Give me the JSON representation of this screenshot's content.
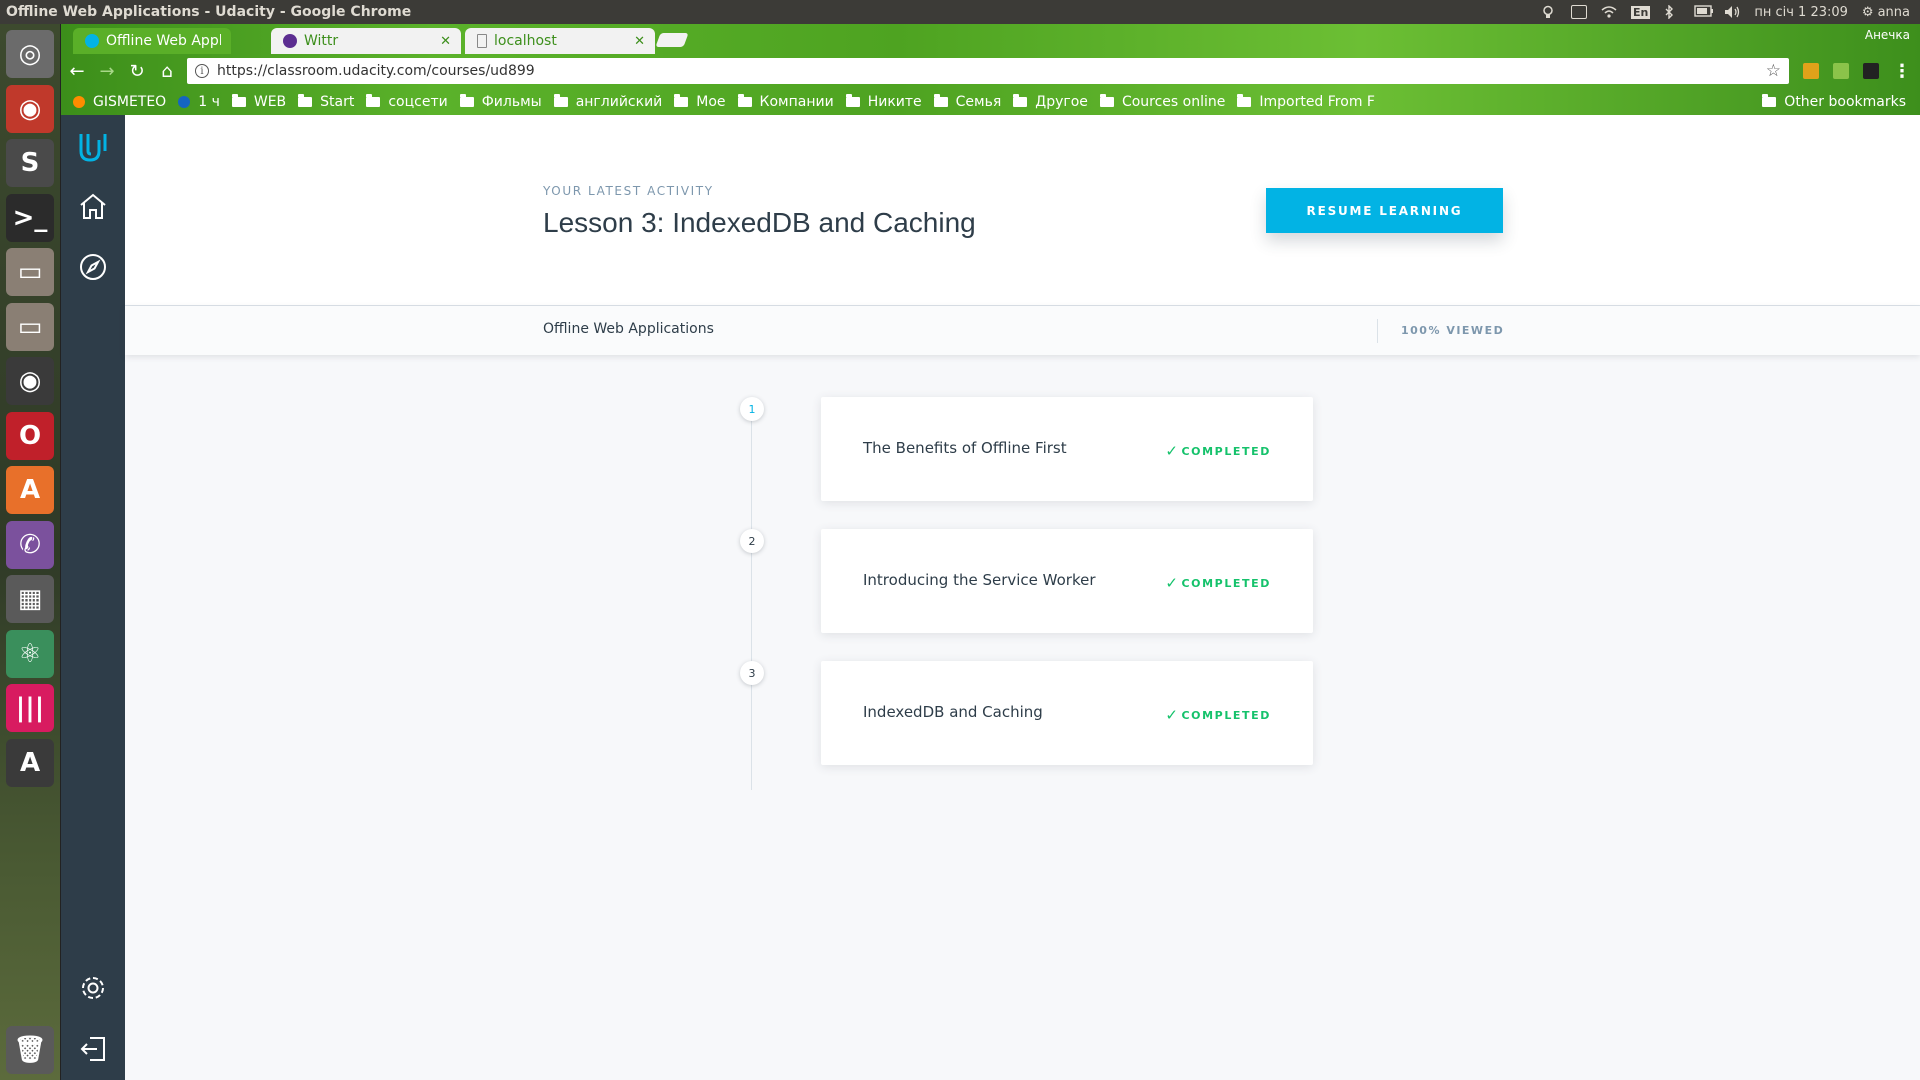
{
  "system": {
    "window_title": "Offline Web Applications - Udacity - Google Chrome",
    "lang": "En",
    "datetime": "пн січ  1 23:09",
    "user": "anna"
  },
  "browser": {
    "tabs": [
      {
        "title": "Offline Web Applic",
        "active": true,
        "favicon_color": "#02b3e4"
      },
      {
        "title": "Wittr",
        "active": false,
        "favicon_color": "#5c2d91"
      },
      {
        "title": "localhost",
        "active": false,
        "favicon_color": "#ffffff"
      }
    ],
    "profile": "Анечка",
    "url": "https://classroom.udacity.com/courses/ud899",
    "bookmarks": [
      {
        "label": "GISMETEO",
        "type": "site",
        "color": "#ff8c00"
      },
      {
        "label": "1 ч",
        "type": "site",
        "color": "#1565c0"
      },
      {
        "label": "WEB",
        "type": "folder"
      },
      {
        "label": "Start",
        "type": "folder"
      },
      {
        "label": "соцсети",
        "type": "folder"
      },
      {
        "label": "Фильмы",
        "type": "folder"
      },
      {
        "label": "английский",
        "type": "folder"
      },
      {
        "label": "Мое",
        "type": "folder"
      },
      {
        "label": "Компании",
        "type": "folder"
      },
      {
        "label": "Никите",
        "type": "folder"
      },
      {
        "label": "Семья",
        "type": "folder"
      },
      {
        "label": "Другое",
        "type": "folder"
      },
      {
        "label": "Cources online",
        "type": "folder"
      },
      {
        "label": "Imported From F",
        "type": "folder"
      }
    ],
    "other_bookmarks": "Other bookmarks"
  },
  "launcher": {
    "items": [
      {
        "icon": "ubuntu-logo-icon",
        "color": "#6b6b6b"
      },
      {
        "icon": "chrome-dev-icon",
        "color": "#c0392b"
      },
      {
        "icon": "sublime-text-icon",
        "color": "#4a4a4a"
      },
      {
        "icon": "terminal-icon",
        "color": "#2b2b2b"
      },
      {
        "icon": "files-icon",
        "color": "#8a7f74"
      },
      {
        "icon": "files-icon",
        "color": "#8a7f74"
      },
      {
        "icon": "chrome-icon",
        "color": "#3a3a3a"
      },
      {
        "icon": "opera-icon",
        "color": "#c0202a"
      },
      {
        "icon": "software-center-icon",
        "color": "#e8702a"
      },
      {
        "icon": "viber-icon",
        "color": "#7b519d"
      },
      {
        "icon": "calculator-icon",
        "color": "#5a5a5a"
      },
      {
        "icon": "atom-icon",
        "color": "#3a8f5c"
      },
      {
        "icon": "sound-app-icon",
        "color": "#d81b60"
      },
      {
        "icon": "software-updater-icon",
        "color": "#3a3a3a"
      },
      {
        "icon": "trash-icon",
        "color": "#5a5a5a"
      }
    ]
  },
  "hero": {
    "eyebrow": "YOUR LATEST ACTIVITY",
    "title": "Lesson 3: IndexedDB and Caching",
    "resume_label": "RESUME LEARNING"
  },
  "course_bar": {
    "name": "Offline Web Applications",
    "viewed": "100% VIEWED"
  },
  "lessons": [
    {
      "number": "1",
      "title": "The Benefits of Offline First",
      "status": "COMPLETED"
    },
    {
      "number": "2",
      "title": "Introducing the Service Worker",
      "status": "COMPLETED"
    },
    {
      "number": "3",
      "title": "IndexedDB and Caching",
      "status": "COMPLETED"
    }
  ],
  "colors": {
    "accent": "#02b3e4",
    "sidebar": "#2e3d49",
    "completed": "#15c26b"
  }
}
